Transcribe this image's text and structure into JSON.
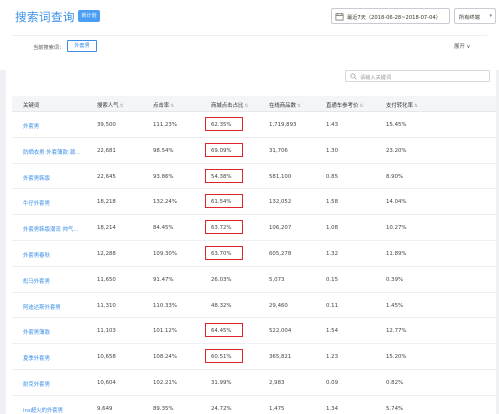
{
  "header": {
    "title": "搜索词查询",
    "badge": "新计划",
    "date_range": "最近7天（2018-06-28~2018-07-04）",
    "terminal": "所有终端"
  },
  "filter": {
    "label": "当前搜索词：",
    "tag": "外套男",
    "expand": "展开"
  },
  "search": {
    "placeholder": "请输入关键词"
  },
  "table": {
    "columns": [
      "关键词",
      "搜索人气",
      "点击率",
      "商城点击占比",
      "在线商品数",
      "直通车参考价",
      "支付转化率"
    ],
    "rows": [
      {
        "keyword": "外套男",
        "popularity": "39,500",
        "ctr": "111.23%",
        "mall_ratio": "62.35%",
        "items": "1,719,893",
        "ref_price": "1.43",
        "conv": "15.45%"
      },
      {
        "keyword": "防晒衣男 外套薄款 潮...",
        "popularity": "22,681",
        "ctr": "98.54%",
        "mall_ratio": "69.09%",
        "items": "31,706",
        "ref_price": "1.30",
        "conv": "23.20%"
      },
      {
        "keyword": "外套男韩版",
        "popularity": "22,645",
        "ctr": "93.86%",
        "mall_ratio": "54.38%",
        "items": "581,100",
        "ref_price": "0.85",
        "conv": "8.90%"
      },
      {
        "keyword": "牛仔外套男",
        "popularity": "18,218",
        "ctr": "132.24%",
        "mall_ratio": "61.54%",
        "items": "132,052",
        "ref_price": "1.58",
        "conv": "14.04%"
      },
      {
        "keyword": "外套男韩版潮流 帅气...",
        "popularity": "18,214",
        "ctr": "84.45%",
        "mall_ratio": "63.72%",
        "items": "106,207",
        "ref_price": "1.08",
        "conv": "10.27%"
      },
      {
        "keyword": "外套男春秋",
        "popularity": "12,288",
        "ctr": "109.30%",
        "mall_ratio": "63.70%",
        "items": "605,278",
        "ref_price": "1.32",
        "conv": "11.89%"
      },
      {
        "keyword": "彪马外套男",
        "popularity": "11,650",
        "ctr": "91.47%",
        "mall_ratio": "26.03%",
        "items": "5,073",
        "ref_price": "0.15",
        "conv": "0.39%"
      },
      {
        "keyword": "阿迪达斯外套男",
        "popularity": "11,310",
        "ctr": "110.33%",
        "mall_ratio": "48.32%",
        "items": "29,460",
        "ref_price": "0.11",
        "conv": "1.45%"
      },
      {
        "keyword": "外套男薄款",
        "popularity": "11,103",
        "ctr": "101.12%",
        "mall_ratio": "64.45%",
        "items": "522,004",
        "ref_price": "1.54",
        "conv": "12.77%"
      },
      {
        "keyword": "夏季外套男",
        "popularity": "10,658",
        "ctr": "108.24%",
        "mall_ratio": "60.51%",
        "items": "365,821",
        "ref_price": "1.23",
        "conv": "15.20%"
      },
      {
        "keyword": "耐克外套男",
        "popularity": "10,604",
        "ctr": "102.21%",
        "mall_ratio": "31.99%",
        "items": "2,983",
        "ref_price": "0.09",
        "conv": "0.82%"
      },
      {
        "keyword": "ins超火的外套男",
        "popularity": "9,649",
        "ctr": "89.35%",
        "mall_ratio": "24.72%",
        "items": "1,475",
        "ref_price": "1.34",
        "conv": "5.74%"
      }
    ],
    "highlighted_rows": [
      0,
      1,
      2,
      3,
      4,
      5,
      8,
      9
    ]
  },
  "colors": {
    "accent": "#3a8ee6",
    "highlight": "#e0242c"
  }
}
